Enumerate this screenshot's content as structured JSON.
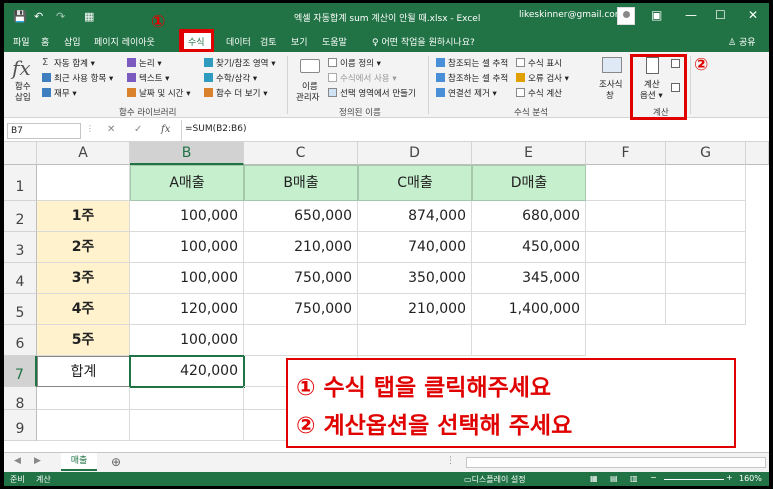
{
  "titlebar": {
    "title": "엑셀 자동합계 sum 계산이 안될 때.xlsx  -  Excel",
    "account": "likeskinner@gmail.com",
    "save_icon": "💾",
    "undo_icon": "↶",
    "redo_icon": "↷",
    "preview_icon": "▦",
    "ribbon_opts": "▣",
    "minimize": "—",
    "maximize": "☐",
    "close": "✕"
  },
  "tabs": {
    "items": [
      "파일",
      "홈",
      "삽입",
      "페이지 레이아웃",
      "수식",
      "데이터",
      "검토",
      "보기",
      "도움말"
    ],
    "active": "수식",
    "tellme": "어떤 작업을 원하시나요?",
    "share": "공유"
  },
  "ribbon": {
    "insert_fn": [
      "함수",
      "삽입"
    ],
    "lib_col1": [
      "자동 합계 ▾",
      "최근 사용 항목 ▾",
      "재무 ▾"
    ],
    "lib_col2": [
      "논리 ▾",
      "텍스트 ▾",
      "날짜 및 시간 ▾"
    ],
    "lib_col3": [
      "찾기/참조 영역 ▾",
      "수학/삼각 ▾",
      "함수 더 보기 ▾"
    ],
    "lib_label": "함수 라이브러리",
    "names_manager": [
      "이름",
      "관리자"
    ],
    "names_col": [
      "이름 정의 ▾",
      "수식에서 사용 ▾",
      "선택 영역에서 만들기"
    ],
    "names_label": "정의된 이름",
    "audit_col1": [
      "참조되는 셀 추적",
      "참조하는 셀 추적",
      "연결선 제거 ▾"
    ],
    "audit_col2": [
      "수식 표시",
      "오류 검사 ▾",
      "수식 계산"
    ],
    "watch": [
      "조사식",
      "창"
    ],
    "audit_label": "수식 분석",
    "calc_opts": [
      "계산",
      "옵션 ▾"
    ],
    "calc_label": "계산"
  },
  "formula_bar": {
    "namebox": "B7",
    "cancel": "✕",
    "enter": "✓",
    "fx": "fx",
    "formula": "=SUM(B2:B6)"
  },
  "columns": [
    "A",
    "B",
    "C",
    "D",
    "E",
    "F",
    "G"
  ],
  "rows": [
    "1",
    "2",
    "3",
    "4",
    "5",
    "6",
    "7",
    "8",
    "9"
  ],
  "sheet": {
    "headers": [
      "A매출",
      "B매출",
      "C매출",
      "D매출"
    ],
    "weeks": [
      "1주",
      "2주",
      "3주",
      "4주",
      "5주"
    ],
    "data": [
      [
        "100,000",
        "650,000",
        "874,000",
        "680,000"
      ],
      [
        "100,000",
        "210,000",
        "740,000",
        "450,000"
      ],
      [
        "100,000",
        "750,000",
        "350,000",
        "345,000"
      ],
      [
        "120,000",
        "750,000",
        "210,000",
        "1,400,000"
      ],
      [
        "100,000",
        "",
        "",
        ""
      ]
    ],
    "total_label": "합계",
    "total_value": "420,000"
  },
  "annotations": {
    "marker1": "①",
    "marker2": "②",
    "line1": "① 수식 탭을 클릭해주세요",
    "line2": "② 계산옵션을 선택해 주세요"
  },
  "sheetbar": {
    "tab": "매출",
    "add": "⊕",
    "display_settings": "디스플레이 설정",
    "zoom": "160%"
  },
  "statusbar": {
    "ready": "준비",
    "calc": "계산"
  },
  "colors": {
    "excel_green": "#217346",
    "header_fill": "#c6efce",
    "week_fill": "#fff2cc",
    "annotation_red": "#e00000"
  }
}
